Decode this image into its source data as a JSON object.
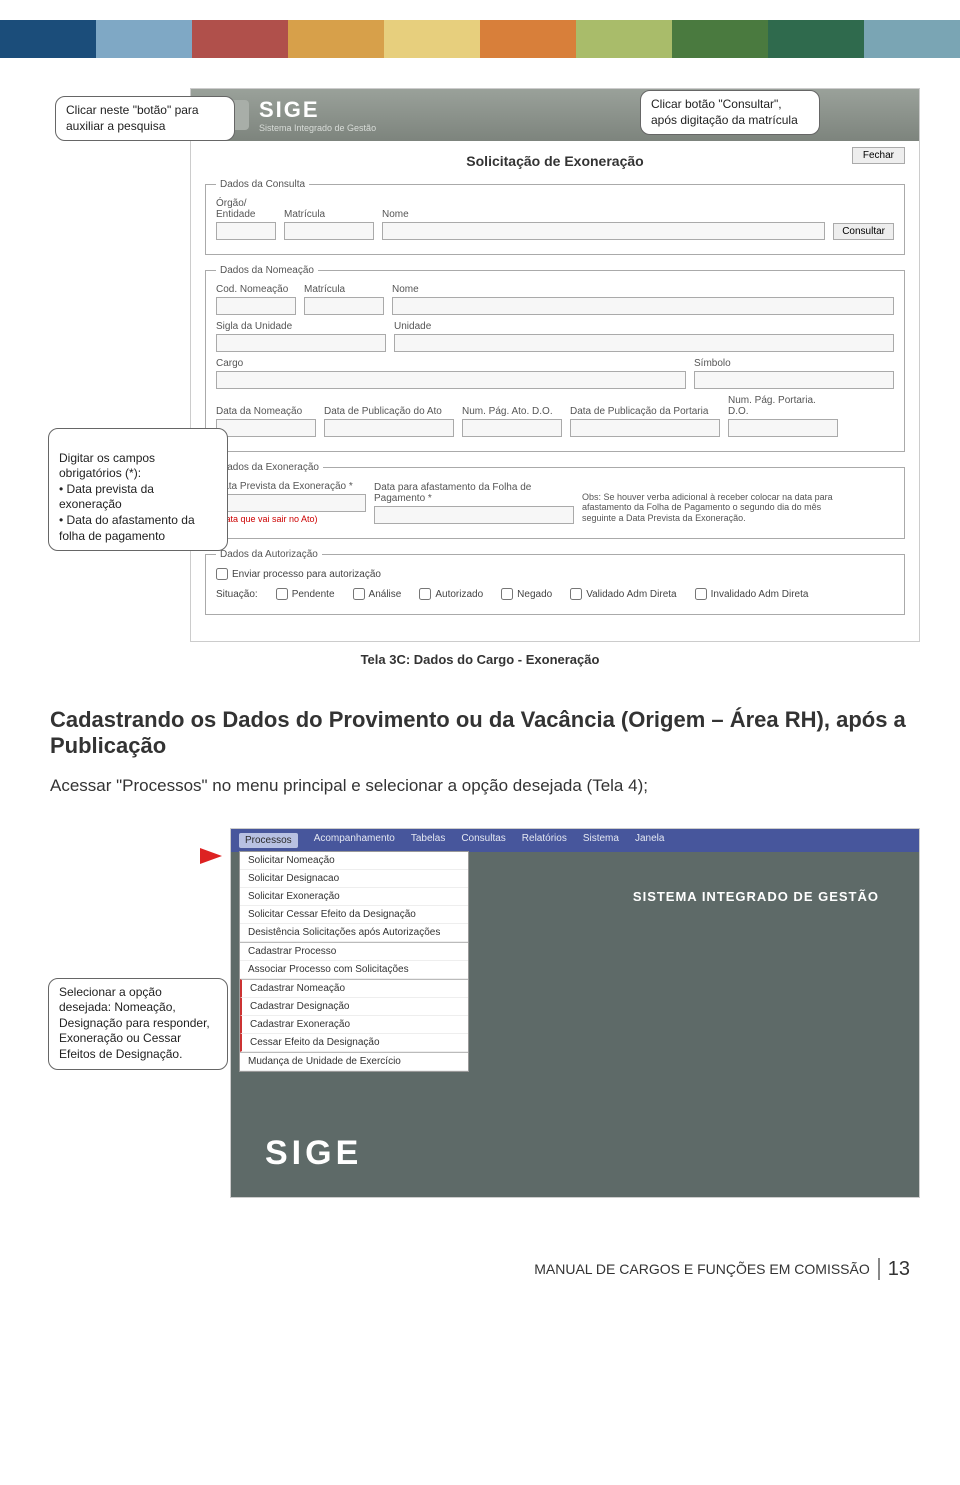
{
  "ribbon_colors": [
    "#1b4d7a",
    "#7fa8c5",
    "#b0504b",
    "#d7a04a",
    "#e7cf7d",
    "#d87f3a",
    "#a9bc6a",
    "#4a7a3f",
    "#2f6a4d",
    "#7aa5b4"
  ],
  "shot1": {
    "brand": "SIGE",
    "brand_sub": "Sistema Integrado de Gestão",
    "title": "Solicitação de Exoneração",
    "fechar": "Fechar",
    "consultar": "Consultar",
    "consulta": {
      "legend": "Dados da Consulta",
      "orgao": "Órgão/ Entidade",
      "matricula": "Matrícula",
      "nome": "Nome"
    },
    "nomeacao": {
      "legend": "Dados da Nomeação",
      "cod": "Cod. Nomeação",
      "matricula": "Matrícula",
      "nome": "Nome",
      "sigla": "Sigla da Unidade",
      "unidade": "Unidade",
      "cargo": "Cargo",
      "simbolo": "Símbolo",
      "datanom": "Data da Nomeação",
      "datapub": "Data de Publicação do Ato",
      "numpag": "Num. Pág. Ato. D.O.",
      "datapubport": "Data de Publicação da Portaria",
      "numpagport": "Num. Pág. Portaria. D.O."
    },
    "exoneracao": {
      "legend": "Dados da Exoneração",
      "dataprev": "Data Prevista da Exoneração *",
      "red": "(Data que vai sair no Ato)",
      "dataafast": "Data para afastamento da Folha de Pagamento *",
      "obs": "Obs: Se houver verba adicional à receber colocar na data para afastamento da Folha de Pagamento o segundo dia do mês seguinte a Data Prevista da Exoneração."
    },
    "autorizacao": {
      "legend": "Dados da Autorização",
      "enviar": "Enviar processo para autorização",
      "situacao": "Situação:",
      "opts": [
        "Pendente",
        "Análise",
        "Autorizado",
        "Negado",
        "Validado Adm Direta",
        "Invalidado Adm Direta"
      ]
    },
    "callouts": {
      "c1": "Clicar neste \"botão\" para auxiliar a pesquisa",
      "c2": "Clicar botão \"Consultar\", após digitação da matrícula",
      "c3": "Digitar os campos obrigatórios (*):\n• Data prevista da exoneração\n• Data do afastamento da folha de pagamento"
    },
    "caption": "Tela 3C: Dados do Cargo - Exoneração"
  },
  "body": {
    "h2": "Cadastrando os Dados do Provimento ou da Vacância (Origem – Área RH), após a Publicação",
    "p": "Acessar \"Processos\" no menu principal e selecionar a opção desejada (Tela 4);"
  },
  "shot2": {
    "menu": [
      "Processos",
      "Acompanhamento",
      "Tabelas",
      "Consultas",
      "Relatórios",
      "Sistema",
      "Janela"
    ],
    "dropdown_top": [
      "Solicitar Nomeação",
      "Solicitar Designacao",
      "Solicitar Exoneração",
      "Solicitar Cessar Efeito da Designação",
      "Desistência Solicitações após Autorizações"
    ],
    "dropdown_mid": [
      "Cadastrar Processo",
      "Associar Processo com Solicitações"
    ],
    "dropdown_red": [
      "Cadastrar Nomeação",
      "Cadastrar Designação",
      "Cadastrar Exoneração",
      "Cessar Efeito da Designação"
    ],
    "dropdown_bot": [
      "Mudança de Unidade de Exercício"
    ],
    "banner": "SISTEMA INTEGRADO DE GESTÃO",
    "sige": "SIGE",
    "callout": "Selecionar a opção desejada: Nomeação, Designação para responder, Exoneração ou Cessar Efeitos de Designação."
  },
  "footer": {
    "text": "MANUAL DE CARGOS E FUNÇÕES EM COMISSÃO",
    "page": "13"
  }
}
